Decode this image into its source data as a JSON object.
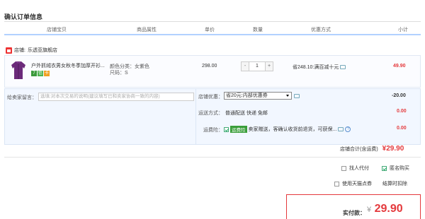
{
  "page_title": "确认订单信息",
  "columns": [
    "店铺宝贝",
    "商品属性",
    "单价",
    "数量",
    "优惠方式",
    "小计"
  ],
  "shop": {
    "label": "店铺:",
    "name": "乐透亚旗舰店"
  },
  "item": {
    "name": "户外抓绒衣男女秋冬季加厚开衫...",
    "badges": [
      "7",
      "信",
      "卡"
    ],
    "attr_color": "颜色分类：女紫色",
    "attr_size": "尺码：S",
    "unit_price": "298.00",
    "quantity": "1",
    "qty_minus": "-",
    "qty_plus": "+",
    "promo": "省248.10:满百减十元",
    "subtotal": "49.90"
  },
  "message": {
    "label": "给卖家留言：",
    "placeholder": "选填:对本次交易的说明(建议填写已和卖家协商一致的内容)"
  },
  "shop_discount": {
    "label": "店铺优惠：",
    "selected": "省20元:内部优惠券",
    "value": "-20.00"
  },
  "shipping": {
    "label": "运送方式：",
    "method": "普通配送 快递 免邮",
    "value": "0.00"
  },
  "insurance": {
    "label": "运费险：",
    "tag": "运费险",
    "text": "卖家赠送，客确认收货前退货，可获保...",
    "value": "0.00"
  },
  "shop_total": {
    "label": "店铺合计(含运费)",
    "value": "¥29.90"
  },
  "options": {
    "proxy_pay": "找人代付",
    "anonymous": "匿名购买",
    "tmall_points": "使用天猫点券",
    "settle_note": "结算时扣除"
  },
  "payment": {
    "label": "实付款：",
    "currency": "¥",
    "value": "29.90"
  },
  "colors": {
    "accent": "#e4393c",
    "header_line": "#b2d1ff",
    "panel_bg": "#f2f7ff"
  }
}
